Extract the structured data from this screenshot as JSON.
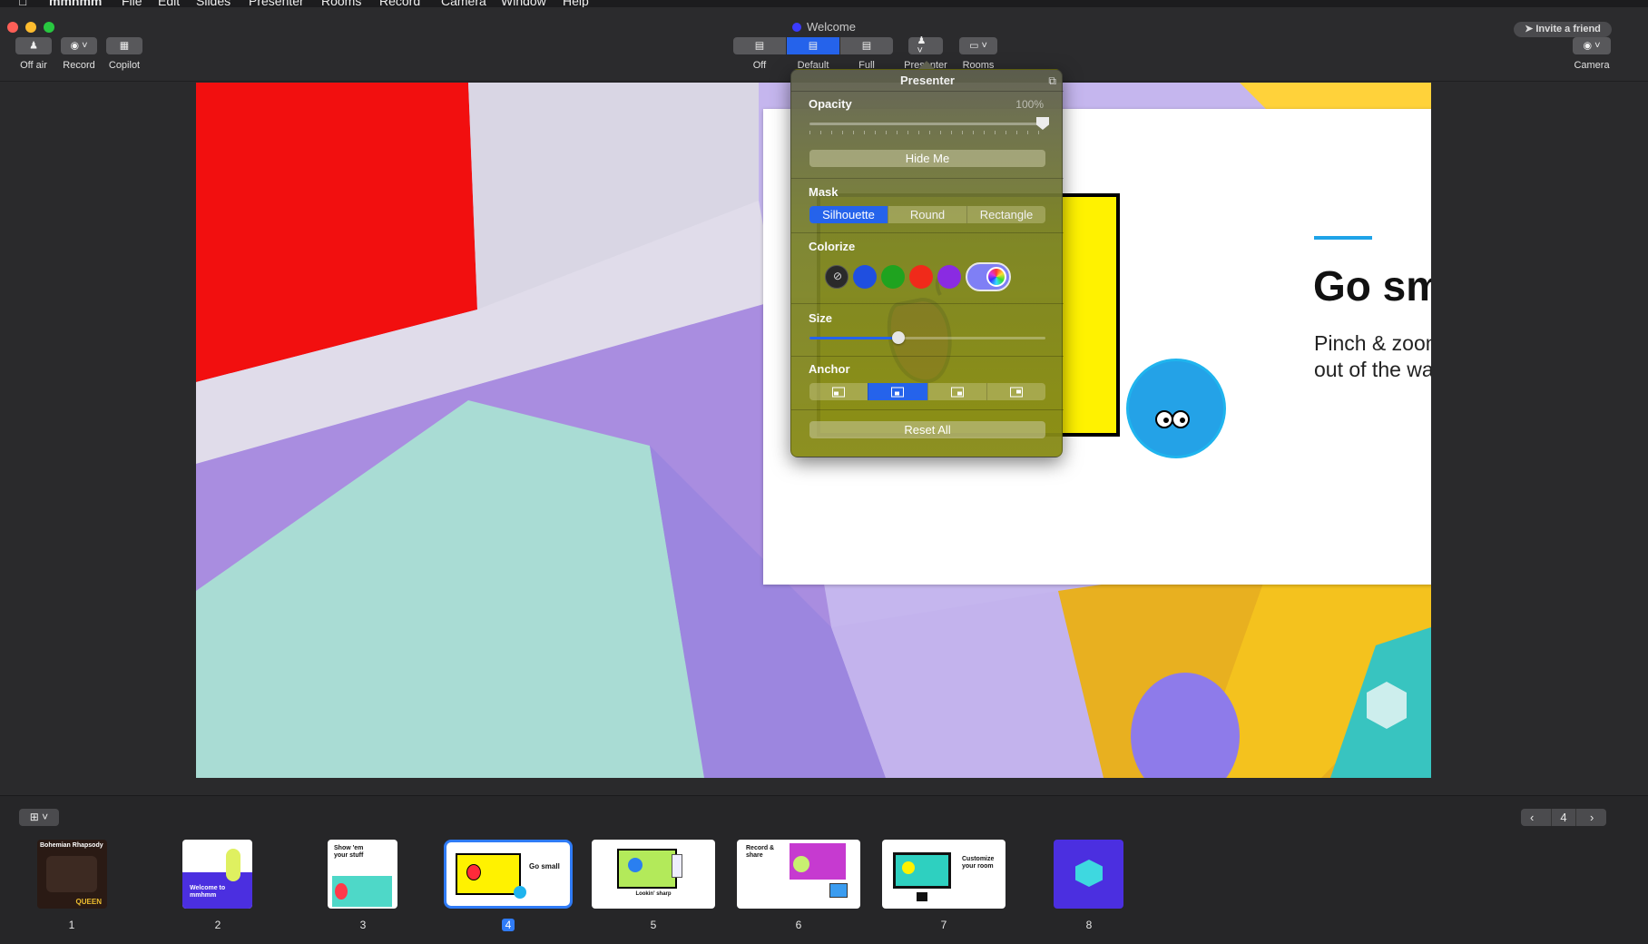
{
  "menubar": {
    "items": [
      "mmhmm",
      "File",
      "Edit",
      "Slides",
      "Presenter",
      "Rooms",
      "Record",
      "Camera",
      "Window",
      "Help"
    ]
  },
  "window": {
    "title": "Welcome",
    "invite_label": "Invite a friend"
  },
  "toolbar": {
    "left": [
      {
        "label": "Off air",
        "icon": "presenter-icon"
      },
      {
        "label": "Record",
        "icon": "record-icon"
      },
      {
        "label": "Copilot",
        "icon": "copilot-icon"
      }
    ],
    "layouts": [
      {
        "label": "Off",
        "icon": "layout-off-icon",
        "selected": false
      },
      {
        "label": "Default",
        "icon": "layout-default-icon",
        "selected": true
      },
      {
        "label": "Full",
        "icon": "layout-full-icon",
        "selected": false
      }
    ],
    "presenter_label": "Presenter",
    "rooms_label": "Rooms",
    "camera_label": "Camera"
  },
  "slide": {
    "title": "Go small",
    "subtitle": "Pinch & zoom to get out of the way",
    "accent_color": "#1ea3e8"
  },
  "presenter_panel": {
    "title": "Presenter",
    "opacity_label": "Opacity",
    "opacity_value": "100%",
    "hide_button": "Hide Me",
    "mask_label": "Mask",
    "mask_options": [
      "Silhouette",
      "Round",
      "Rectangle"
    ],
    "mask_selected": "Silhouette",
    "colorize_label": "Colorize",
    "colorize_swatches": [
      "#2a2a2a",
      "#1f4fe0",
      "#1fa31f",
      "#f02a1a",
      "#8a2be2"
    ],
    "size_label": "Size",
    "size_value": 0.38,
    "anchor_label": "Anchor",
    "anchor_selected_index": 1,
    "reset_button": "Reset All"
  },
  "slide_tray": {
    "add_icon": "add-slide-icon",
    "current_page": "4",
    "slides": [
      {
        "number": "1",
        "caption": "Bohemian Rhapsody",
        "sub": "QUEEN",
        "bg": "#2a1a14"
      },
      {
        "number": "2",
        "caption": "Welcome to mmhmm",
        "sub": "",
        "bg": "#4b2fe0"
      },
      {
        "number": "3",
        "caption": "Show 'em your stuff",
        "sub": "",
        "bg": "#ffffff"
      },
      {
        "number": "4",
        "caption": "Go small",
        "sub": "",
        "bg": "#ffffff"
      },
      {
        "number": "5",
        "caption": "Lookin' sharp",
        "sub": "",
        "bg": "#ffffff"
      },
      {
        "number": "6",
        "caption": "Record & share",
        "sub": "",
        "bg": "#ffffff"
      },
      {
        "number": "7",
        "caption": "Customize your room",
        "sub": "",
        "bg": "#ffffff"
      },
      {
        "number": "8",
        "caption": "",
        "sub": "",
        "bg": "#4b2fe0"
      }
    ]
  }
}
